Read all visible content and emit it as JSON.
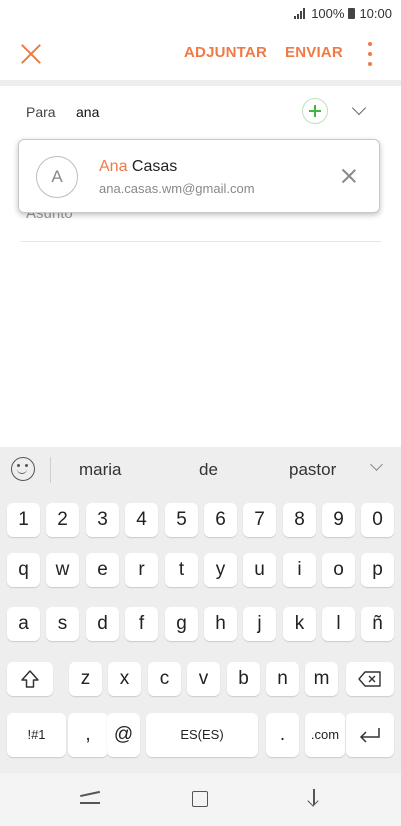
{
  "status_bar": {
    "battery": "100%",
    "time": "10:00"
  },
  "toolbar": {
    "attach_label": "ADJUNTAR",
    "send_label": "ENVIAR"
  },
  "compose": {
    "to_label": "Para",
    "to_value": "ana",
    "subject_placeholder": "Asunto"
  },
  "suggestion": {
    "avatar_initial": "A",
    "name_match": "Ana",
    "name_rest": " Casas",
    "email": "ana.casas.wm@gmail.com"
  },
  "keyboard": {
    "predictions": [
      "maria",
      "de",
      "pastor"
    ],
    "row_numbers": [
      "1",
      "2",
      "3",
      "4",
      "5",
      "6",
      "7",
      "8",
      "9",
      "0"
    ],
    "row_top": [
      "q",
      "w",
      "e",
      "r",
      "t",
      "y",
      "u",
      "i",
      "o",
      "p"
    ],
    "row_mid": [
      "a",
      "s",
      "d",
      "f",
      "g",
      "h",
      "j",
      "k",
      "l",
      "ñ"
    ],
    "row_low": [
      "z",
      "x",
      "c",
      "v",
      "b",
      "n",
      "m"
    ],
    "symbols_label": "!#1",
    "comma": ",",
    "at": "@",
    "language_label": "ES(ES)",
    "period": ".",
    "dotcom": ".com"
  },
  "accent_color": "#f07a46"
}
